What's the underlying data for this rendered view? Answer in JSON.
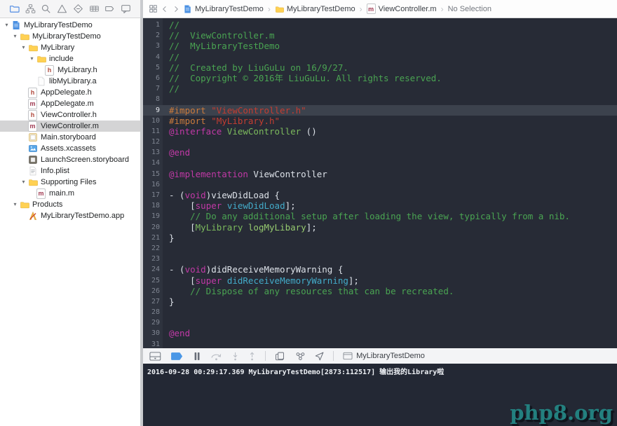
{
  "palette": {
    "editor_bg": "#272b36",
    "gutter_bg": "#2e333e",
    "gutter_fg": "#7f8591",
    "hl_row": "#3c424d",
    "plain": "#dce1e8",
    "cm": "#4aa452",
    "pp": "#cb7b3c",
    "str": "#c43d31",
    "kw": "#c139a6",
    "cy": "#43abc9",
    "cls": "#7cba5d",
    "fn": "#96ca6f",
    "console_bg": "#232834",
    "accent_blue": "#3f80e0",
    "breakpoint_blue": "#4a97e6",
    "watermark_teal": "#23807f",
    "selection_gray": "#d4d4d5",
    "folder_yellow": "#ffd153"
  },
  "navigator": {
    "toolbar_icons": [
      {
        "name": "project-navigator-icon",
        "icon": "folder-outline",
        "active": true
      },
      {
        "name": "symbol-navigator-icon",
        "icon": "symbol"
      },
      {
        "name": "find-navigator-icon",
        "icon": "search"
      },
      {
        "name": "issue-navigator-icon",
        "icon": "warning"
      },
      {
        "name": "test-navigator-icon",
        "icon": "test"
      },
      {
        "name": "debug-navigator-icon",
        "icon": "table"
      },
      {
        "name": "breakpoint-navigator-icon",
        "icon": "bp-tag"
      },
      {
        "name": "report-navigator-icon",
        "icon": "report"
      }
    ],
    "tree": [
      {
        "label": "MyLibraryTestDemo",
        "icon": "project-file",
        "indent": 0,
        "disclosure": true
      },
      {
        "label": "MyLibraryTestDemo",
        "icon": "folder",
        "indent": 1,
        "disclosure": true
      },
      {
        "label": "MyLibrary",
        "icon": "folder",
        "indent": 2,
        "disclosure": true
      },
      {
        "label": "include",
        "icon": "folder",
        "indent": 3,
        "disclosure": true
      },
      {
        "label": "MyLibrary.h",
        "icon": "h-file",
        "indent": 4
      },
      {
        "label": "libMyLibrary.a",
        "icon": "doc-file",
        "indent": 3
      },
      {
        "label": "AppDelegate.h",
        "icon": "h-file",
        "indent": 2
      },
      {
        "label": "AppDelegate.m",
        "icon": "m-file",
        "indent": 2
      },
      {
        "label": "ViewController.h",
        "icon": "h-file",
        "indent": 2
      },
      {
        "label": "ViewController.m",
        "icon": "m-file",
        "indent": 2,
        "selected": true
      },
      {
        "label": "Main.storyboard",
        "icon": "storyboard",
        "indent": 2
      },
      {
        "label": "Assets.xcassets",
        "icon": "xcassets",
        "indent": 2
      },
      {
        "label": "LaunchScreen.storyboard",
        "icon": "storyboard-dark",
        "indent": 2
      },
      {
        "label": "Info.plist",
        "icon": "plist",
        "indent": 2
      },
      {
        "label": "Supporting Files",
        "icon": "folder",
        "indent": 2,
        "disclosure": true
      },
      {
        "label": "main.m",
        "icon": "m-file",
        "indent": 3
      },
      {
        "label": "Products",
        "icon": "folder",
        "indent": 1,
        "disclosure": true
      },
      {
        "label": "MyLibraryTestDemo.app",
        "icon": "app-file",
        "indent": 2
      }
    ]
  },
  "jumpbar": {
    "crumbs": [
      {
        "label": "MyLibraryTestDemo",
        "icon": "project-file"
      },
      {
        "label": "MyLibraryTestDemo",
        "icon": "folder"
      },
      {
        "label": "ViewController.m",
        "icon": "m-file"
      },
      {
        "label": "No Selection",
        "icon": null,
        "muted": true
      }
    ]
  },
  "editor": {
    "lines": [
      {
        "n": 1,
        "tokens": [
          {
            "t": "//",
            "c": "cm"
          }
        ]
      },
      {
        "n": 2,
        "tokens": [
          {
            "t": "//  ViewController.m",
            "c": "cm"
          }
        ]
      },
      {
        "n": 3,
        "tokens": [
          {
            "t": "//  MyLibraryTestDemo",
            "c": "cm"
          }
        ]
      },
      {
        "n": 4,
        "tokens": [
          {
            "t": "//",
            "c": "cm"
          }
        ]
      },
      {
        "n": 5,
        "tokens": [
          {
            "t": "//  Created by LiuGuLu on 16/9/27.",
            "c": "cm"
          }
        ]
      },
      {
        "n": 6,
        "tokens": [
          {
            "t": "//  Copyright © 2016年 LiuGuLu. All rights reserved.",
            "c": "cm"
          }
        ]
      },
      {
        "n": 7,
        "tokens": [
          {
            "t": "//",
            "c": "cm"
          }
        ]
      },
      {
        "n": 8,
        "tokens": []
      },
      {
        "n": 9,
        "hl": true,
        "tokens": [
          {
            "t": "#import",
            "c": "pp"
          },
          {
            "t": " ",
            "c": "pl"
          },
          {
            "t": "\"ViewController.h\"",
            "c": "str"
          }
        ]
      },
      {
        "n": 10,
        "tokens": [
          {
            "t": "#import",
            "c": "pp"
          },
          {
            "t": " ",
            "c": "pl"
          },
          {
            "t": "\"MyLibrary.h\"",
            "c": "str"
          }
        ]
      },
      {
        "n": 11,
        "tokens": [
          {
            "t": "@interface",
            "c": "kw"
          },
          {
            "t": " ",
            "c": "pl"
          },
          {
            "t": "ViewController",
            "c": "cls"
          },
          {
            "t": " ()",
            "c": "pl"
          }
        ]
      },
      {
        "n": 12,
        "tokens": []
      },
      {
        "n": 13,
        "tokens": [
          {
            "t": "@end",
            "c": "kw"
          }
        ]
      },
      {
        "n": 14,
        "tokens": []
      },
      {
        "n": 15,
        "tokens": [
          {
            "t": "@implementation",
            "c": "kw"
          },
          {
            "t": " ViewController",
            "c": "pl"
          }
        ]
      },
      {
        "n": 16,
        "tokens": []
      },
      {
        "n": 17,
        "tokens": [
          {
            "t": "- (",
            "c": "pl"
          },
          {
            "t": "void",
            "c": "kw"
          },
          {
            "t": ")viewDidLoad {",
            "c": "pl"
          }
        ]
      },
      {
        "n": 18,
        "tokens": [
          {
            "t": "    [",
            "c": "pl"
          },
          {
            "t": "super",
            "c": "kw"
          },
          {
            "t": " ",
            "c": "pl"
          },
          {
            "t": "viewDidLoad",
            "c": "cy"
          },
          {
            "t": "];",
            "c": "pl"
          }
        ]
      },
      {
        "n": 19,
        "tokens": [
          {
            "t": "    // Do any additional setup after loading the view, typically from a nib.",
            "c": "cm"
          }
        ]
      },
      {
        "n": 20,
        "tokens": [
          {
            "t": "    [",
            "c": "pl"
          },
          {
            "t": "MyLibrary",
            "c": "cls"
          },
          {
            "t": " ",
            "c": "pl"
          },
          {
            "t": "logMyLibary",
            "c": "fn"
          },
          {
            "t": "];",
            "c": "pl"
          }
        ]
      },
      {
        "n": 21,
        "tokens": [
          {
            "t": "}",
            "c": "pl"
          }
        ]
      },
      {
        "n": 22,
        "tokens": []
      },
      {
        "n": 23,
        "tokens": []
      },
      {
        "n": 24,
        "tokens": [
          {
            "t": "- (",
            "c": "pl"
          },
          {
            "t": "void",
            "c": "kw"
          },
          {
            "t": ")didReceiveMemoryWarning {",
            "c": "pl"
          }
        ]
      },
      {
        "n": 25,
        "tokens": [
          {
            "t": "    [",
            "c": "pl"
          },
          {
            "t": "super",
            "c": "kw"
          },
          {
            "t": " ",
            "c": "pl"
          },
          {
            "t": "didReceiveMemoryWarning",
            "c": "cy"
          },
          {
            "t": "];",
            "c": "pl"
          }
        ]
      },
      {
        "n": 26,
        "tokens": [
          {
            "t": "    // Dispose of any resources that can be recreated.",
            "c": "cm"
          }
        ]
      },
      {
        "n": 27,
        "tokens": [
          {
            "t": "}",
            "c": "pl"
          }
        ]
      },
      {
        "n": 28,
        "tokens": []
      },
      {
        "n": 29,
        "tokens": []
      },
      {
        "n": 30,
        "tokens": [
          {
            "t": "@end",
            "c": "kw"
          }
        ]
      },
      {
        "n": 31,
        "tokens": []
      }
    ]
  },
  "debugbar": {
    "icons": [
      {
        "name": "hide-debug-area-icon",
        "icon": "hide-debug",
        "state": "normal"
      },
      {
        "name": "breakpoints-toggle-icon",
        "icon": "bp-fill",
        "state": "active"
      },
      {
        "name": "pause-execution-icon",
        "icon": "pause",
        "state": "normal"
      },
      {
        "name": "step-over-icon",
        "icon": "step-over",
        "state": "disabled"
      },
      {
        "name": "step-into-icon",
        "icon": "step-into",
        "state": "disabled"
      },
      {
        "name": "step-out-icon",
        "icon": "step-out",
        "state": "disabled"
      },
      {
        "divider": true
      },
      {
        "name": "view-hierarchy-icon",
        "icon": "view-hierarchy",
        "state": "normal"
      },
      {
        "name": "memory-graph-icon",
        "icon": "memory-graph",
        "state": "normal"
      },
      {
        "name": "simulate-location-icon",
        "icon": "location-arrow",
        "state": "normal"
      },
      {
        "divider": true
      }
    ],
    "target_label": "MyLibraryTestDemo"
  },
  "console": {
    "log": "2016-09-28 00:29:17.369 MyLibraryTestDemo[2873:112517] 输出我的Library啦"
  },
  "watermark": "php8.org"
}
